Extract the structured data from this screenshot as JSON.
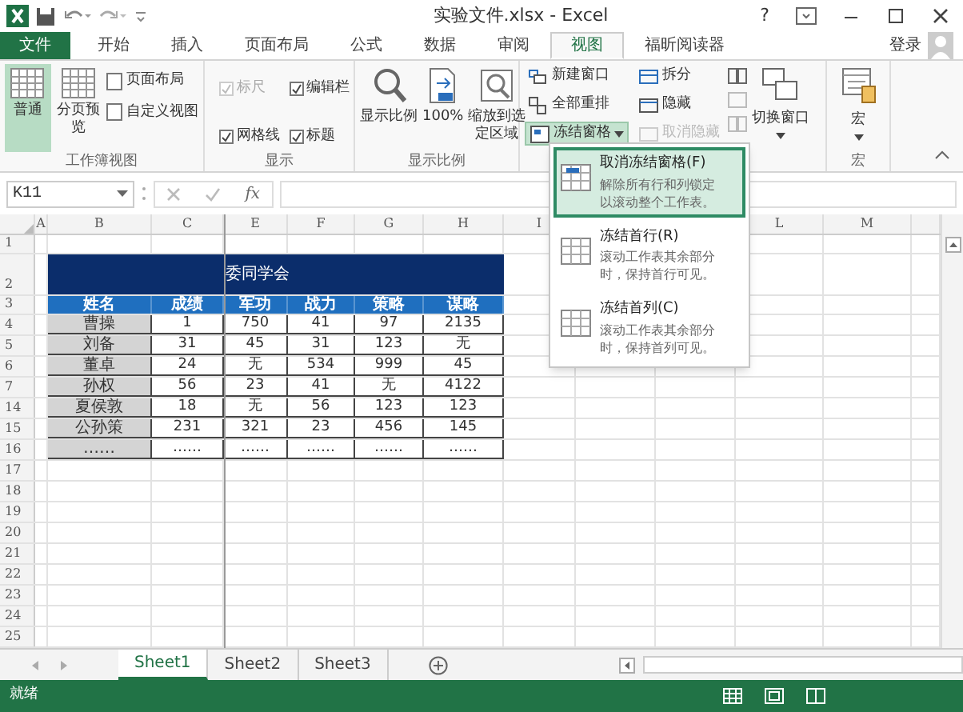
{
  "title_bar": {
    "title": "实验文件.xlsx - Excel",
    "help": "?"
  },
  "ribbon_tabs": [
    {
      "label": "文件",
      "kind": "file",
      "selected": false
    },
    {
      "label": "开始",
      "kind": "tab",
      "selected": false
    },
    {
      "label": "插入",
      "kind": "tab",
      "selected": false
    },
    {
      "label": "页面布局",
      "kind": "tab",
      "selected": false
    },
    {
      "label": "公式",
      "kind": "tab",
      "selected": false
    },
    {
      "label": "数据",
      "kind": "tab",
      "selected": false
    },
    {
      "label": "审阅",
      "kind": "tab",
      "selected": false
    },
    {
      "label": "视图",
      "kind": "tab",
      "selected": true
    },
    {
      "label": "福昕阅读器",
      "kind": "tab",
      "selected": false
    }
  ],
  "account": {
    "label": "登录"
  },
  "ribbon": {
    "workbook_views": {
      "label": "工作簿视图",
      "large": [
        {
          "label": "普通",
          "selected": true
        },
        {
          "label": "分页预览",
          "selected": false
        }
      ],
      "small": [
        "页面布局",
        "自定义视图"
      ]
    },
    "show": {
      "label": "显示",
      "checkboxes": [
        {
          "label": "标尺",
          "checked": true,
          "disabled": true
        },
        {
          "label": "编辑栏",
          "checked": true,
          "disabled": false
        },
        {
          "label": "网格线",
          "checked": true,
          "disabled": false
        },
        {
          "label": "标题",
          "checked": true,
          "disabled": false
        }
      ]
    },
    "zoom": {
      "label": "显示比例",
      "buttons": [
        "显示比例",
        "100%",
        "缩放到选定区域"
      ]
    },
    "window": {
      "small": [
        {
          "label": "新建窗口",
          "disabled": false,
          "selected": false
        },
        {
          "label": "拆分",
          "disabled": false,
          "selected": false
        },
        {
          "label": "全部重排",
          "disabled": false,
          "selected": false
        },
        {
          "label": "隐藏",
          "disabled": false,
          "selected": false
        },
        {
          "label": "冻结窗格",
          "disabled": false,
          "selected": true
        },
        {
          "label": "取消隐藏",
          "disabled": true,
          "selected": false
        }
      ],
      "switch": "切换窗口"
    },
    "macros": {
      "label": "宏",
      "button": "宏"
    }
  },
  "formula_bar": {
    "name_box": "K11",
    "fx": "fx"
  },
  "columns": [
    "A",
    "B",
    "C",
    "E",
    "F",
    "G",
    "H",
    "I",
    "L",
    "M"
  ],
  "row_numbers": [
    "1",
    "2",
    "3",
    "4",
    "5",
    "6",
    "7",
    "14",
    "15",
    "16",
    "17",
    "18",
    "19",
    "20",
    "21",
    "22",
    "23",
    "24",
    "25"
  ],
  "table": {
    "title": "委同学会",
    "headers": [
      "姓名",
      "成绩",
      "军功",
      "战力",
      "策略",
      "谋略"
    ],
    "rows": [
      [
        "曹操",
        "1",
        "750",
        "41",
        "97",
        "2135"
      ],
      [
        "刘备",
        "31",
        "45",
        "31",
        "123",
        "无"
      ],
      [
        "董卓",
        "24",
        "无",
        "534",
        "999",
        "45"
      ],
      [
        "孙权",
        "56",
        "23",
        "41",
        "无",
        "4122"
      ],
      [
        "夏侯敦",
        "18",
        "无",
        "56",
        "123",
        "123"
      ],
      [
        "公孙策",
        "231",
        "321",
        "23",
        "456",
        "145"
      ],
      [
        "……",
        "……",
        "……",
        "……",
        "……",
        "……"
      ]
    ]
  },
  "freeze_menu": [
    {
      "title": "取消冻结窗格(F)",
      "description": "解除所有行和列锁定以滚动整个工作表。",
      "selected": true
    },
    {
      "title": "冻结首行(R)",
      "description": "滚动工作表其余部分时，保持首行可见。",
      "selected": false
    },
    {
      "title": "冻结首列(C)",
      "description": "滚动工作表其余部分时，保持首列可见。",
      "selected": false
    }
  ],
  "sheet_tabs": [
    {
      "label": "Sheet1",
      "selected": true
    },
    {
      "label": "Sheet2",
      "selected": false
    },
    {
      "label": "Sheet3",
      "selected": false
    }
  ],
  "status_bar": {
    "status": "就绪"
  }
}
